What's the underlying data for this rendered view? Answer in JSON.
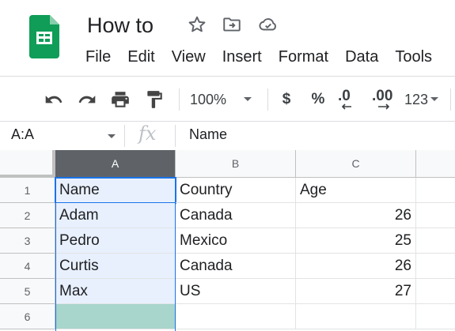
{
  "app": {
    "document_title": "How to",
    "title_icons": [
      "star-icon",
      "move-to-folder-icon",
      "cloud-saved-icon"
    ]
  },
  "menu": [
    "File",
    "Edit",
    "View",
    "Insert",
    "Format",
    "Data",
    "Tools"
  ],
  "toolbar": {
    "zoom": "100%",
    "currency_label": "$",
    "percent_label": "%",
    "decrease_decimals_label": ".0",
    "increase_decimals_label": ".00",
    "more_formats_label": "123"
  },
  "formula_bar": {
    "name_box": "A:A",
    "fx_label": "fx",
    "value": "Name"
  },
  "sheet": {
    "columns": [
      "A",
      "B",
      "C"
    ],
    "selected_column": "A",
    "rows": [
      {
        "num": "1",
        "cells": [
          "Name",
          "Country",
          "Age"
        ]
      },
      {
        "num": "2",
        "cells": [
          "Adam",
          "Canada",
          "26"
        ]
      },
      {
        "num": "3",
        "cells": [
          "Pedro",
          "Mexico",
          "25"
        ]
      },
      {
        "num": "4",
        "cells": [
          "Curtis",
          "Canada",
          "26"
        ]
      },
      {
        "num": "5",
        "cells": [
          "Max",
          "US",
          "27"
        ]
      },
      {
        "num": "6",
        "cells": [
          "",
          "",
          ""
        ]
      }
    ]
  },
  "colors": {
    "selection_blue": "#1a73e8",
    "selected_range_fill": "#e8f0fe",
    "logo_green": "#0f9d58"
  }
}
